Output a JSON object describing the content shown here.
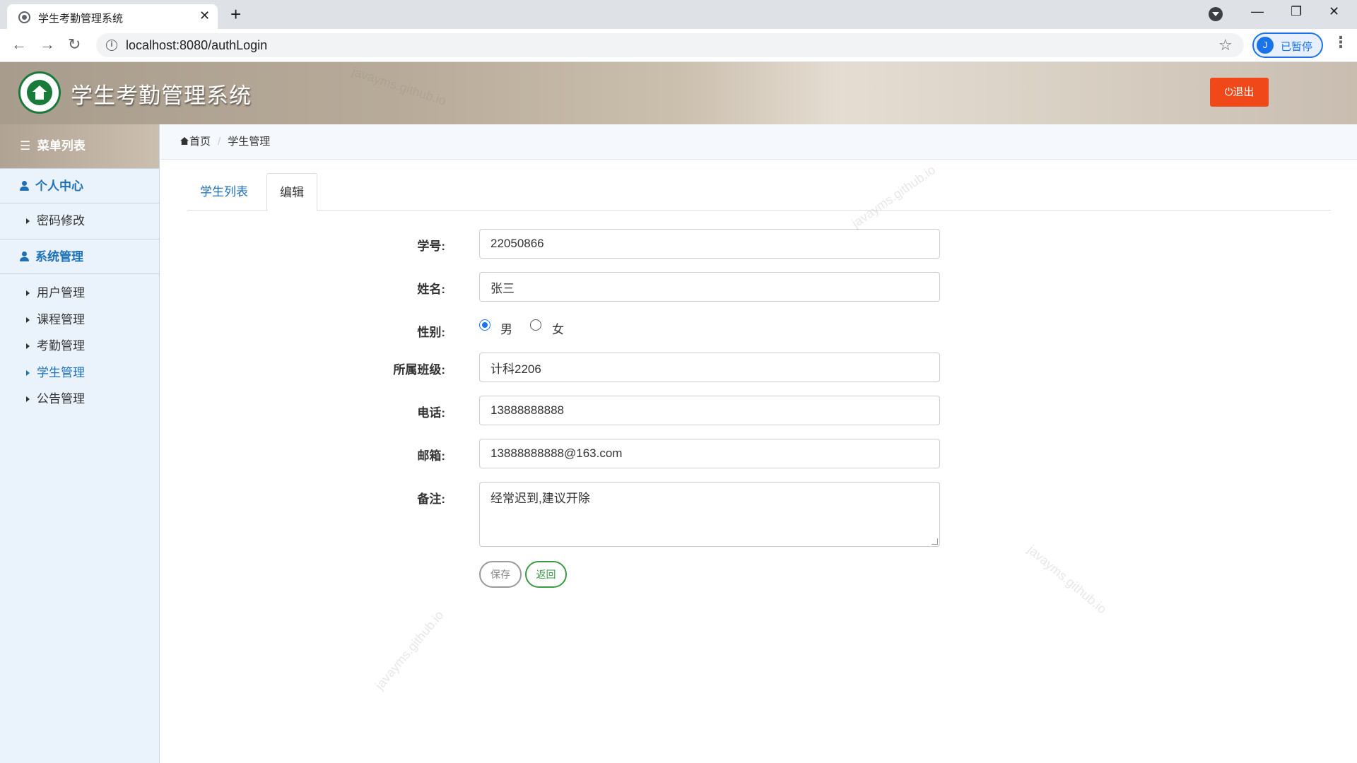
{
  "browser": {
    "tab_title": "学生考勤管理系统",
    "tab_close": "✕",
    "new_tab": "+",
    "url": "localhost:8080/authLogin",
    "profile_initial": "J",
    "profile_label": "已暂停",
    "icons": [
      "back-icon",
      "forward-icon",
      "reload-icon",
      "info-icon",
      "star-icon",
      "more-icon",
      "minimize-icon",
      "restore-icon",
      "close-icon"
    ]
  },
  "header": {
    "title": "学生考勤管理系统",
    "logout_label": "⏻退出",
    "logout_color": "#f04818"
  },
  "sidebar": {
    "heading": "菜单列表",
    "sections": [
      {
        "label": "个人中心",
        "items": [
          {
            "label": "密码修改"
          }
        ]
      },
      {
        "label": "系统管理",
        "items": [
          {
            "label": "用户管理"
          },
          {
            "label": "课程管理"
          },
          {
            "label": "考勤管理"
          },
          {
            "label": "学生管理"
          },
          {
            "label": "公告管理"
          }
        ]
      }
    ],
    "active_item": "学生管理",
    "accent": "#1e70b8"
  },
  "breadcrumb": {
    "home": "首页",
    "current": "学生管理"
  },
  "tabs": [
    {
      "label": "学生列表",
      "active": false
    },
    {
      "label": "编辑",
      "active": true
    }
  ],
  "form": {
    "student_id": {
      "label": "学号:",
      "value": "22050866"
    },
    "name": {
      "label": "姓名:",
      "value": "张三"
    },
    "gender": {
      "label": "性别:",
      "options": [
        "男",
        "女"
      ],
      "selected": "男"
    },
    "class": {
      "label": "所属班级:",
      "value": "计科2206"
    },
    "phone": {
      "label": "电话:",
      "value": "13888888888"
    },
    "email": {
      "label": "邮箱:",
      "value": "13888888888@163.com"
    },
    "remark": {
      "label": "备注:",
      "value": "经常迟到,建议开除"
    },
    "save_label": "保存",
    "back_label": "返回"
  },
  "watermark": "javayms.github.io"
}
